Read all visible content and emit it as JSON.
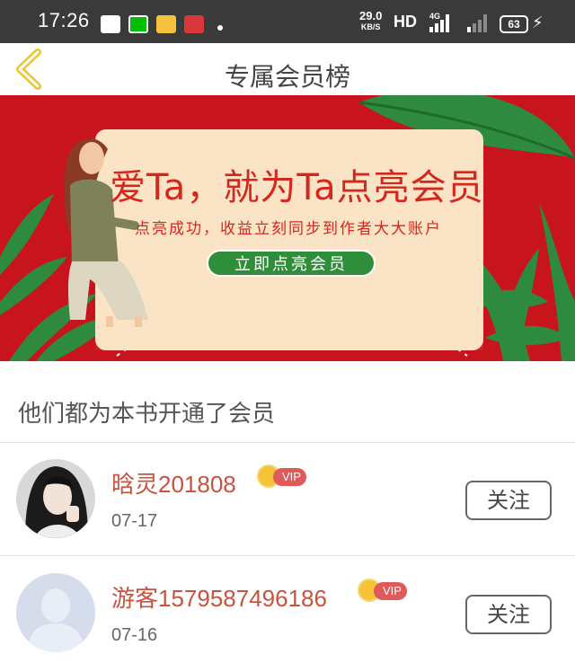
{
  "status_bar": {
    "time": "17:26",
    "net_speed": "29.0",
    "net_unit": "KB/S",
    "hd": "HD",
    "network": "4G",
    "battery": "63",
    "icons": [
      "mail-icon",
      "iqiyi-icon",
      "weibo-icon",
      "app-icon",
      "notification-dot",
      "signal-icon",
      "battery-icon",
      "charging-icon"
    ]
  },
  "header": {
    "title": "专属会员榜",
    "back_icon": "chevron-left-icon",
    "accent_color": "#f2c12e"
  },
  "banner": {
    "headline": "爱Ta，就为Ta点亮会员",
    "subtitle": "点亮成功，收益立刻同步到作者大大账户",
    "cta": "立即点亮会员",
    "background_color": "#c8141c"
  },
  "section": {
    "title": "他们都为本书开通了会员"
  },
  "members": [
    {
      "name": "晗灵201808",
      "badge": "VIP",
      "date": "07-17",
      "follow_label": "关注"
    },
    {
      "name": "游客1579587496186",
      "badge": "VIP",
      "date": "07-16",
      "follow_label": "关注"
    }
  ]
}
